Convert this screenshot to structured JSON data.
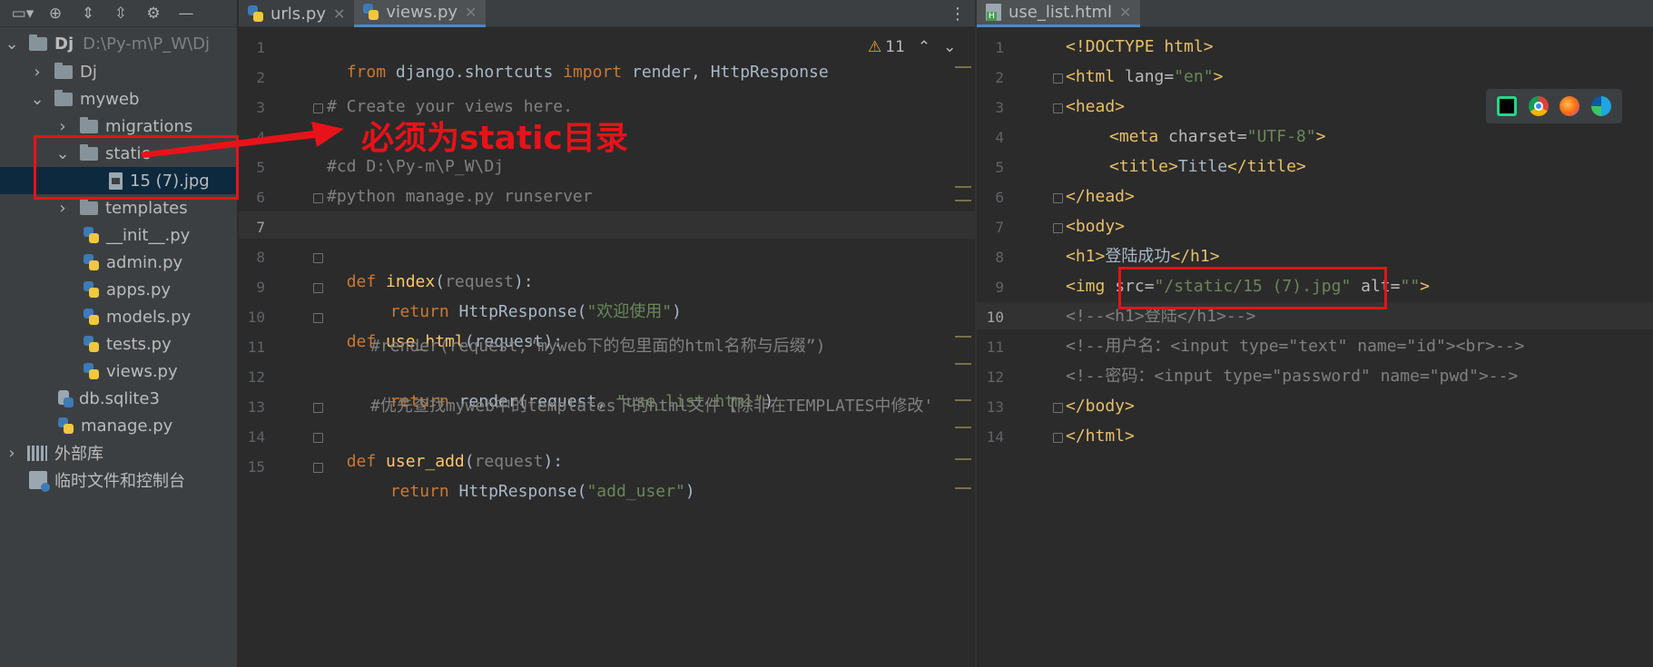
{
  "project": {
    "toolbar_icons": [
      "project-view-icon",
      "locate-icon",
      "expand-all-icon",
      "collapse-all-icon",
      "gear-icon",
      "hide-icon"
    ],
    "tree": [
      {
        "label": "Dj",
        "path": "D:\\Py-m\\P_W\\Dj",
        "type": "folder",
        "expanded": true
      },
      {
        "label": "Dj",
        "type": "folder",
        "expanded": false
      },
      {
        "label": "myweb",
        "type": "folder",
        "expanded": true
      },
      {
        "label": "migrations",
        "type": "folder",
        "expanded": false
      },
      {
        "label": "static",
        "type": "folder",
        "expanded": true
      },
      {
        "label": "15 (7).jpg",
        "type": "image"
      },
      {
        "label": "templates",
        "type": "folder",
        "expanded": false
      },
      {
        "label": "__init__.py",
        "type": "python"
      },
      {
        "label": "admin.py",
        "type": "python"
      },
      {
        "label": "apps.py",
        "type": "python"
      },
      {
        "label": "models.py",
        "type": "python"
      },
      {
        "label": "tests.py",
        "type": "python"
      },
      {
        "label": "views.py",
        "type": "python"
      },
      {
        "label": "db.sqlite3",
        "type": "db"
      },
      {
        "label": "manage.py",
        "type": "python"
      },
      {
        "label": "外部库",
        "type": "libs"
      },
      {
        "label": "临时文件和控制台",
        "type": "scratch"
      }
    ]
  },
  "left_editor": {
    "tabs": [
      {
        "label": "urls.py",
        "active": false
      },
      {
        "label": "views.py",
        "active": true
      }
    ],
    "warnings": "11",
    "current_line": "7",
    "line_numbers": [
      "1",
      "2",
      "3",
      "4",
      "5",
      "6",
      "7",
      "8",
      "9",
      "10",
      "11",
      "12",
      "13",
      "14",
      "15"
    ],
    "lines": {
      "l1": {
        "kw1": "from",
        "mod": " django.shortcuts ",
        "kw2": "import",
        "rest": " render, HttpResponse"
      },
      "l3": "# Create your views here.",
      "l5": "#cd D:\\Py-m\\P_W\\Dj",
      "l6": "#python manage.py runserver",
      "l8": {
        "kw": "def",
        "fn": "index",
        "open": "(",
        "param": "request",
        "close": "):"
      },
      "l9": {
        "kw": "return",
        "call": " HttpResponse(",
        "str": "\"欢迎使用\"",
        "close": ")"
      },
      "l10": {
        "kw": "def",
        "fn": "use_html",
        "rest": "(request):"
      },
      "l11": "#render(request,“myweb下的包里面的html名称与后缀”)",
      "l12": {
        "kw": "return",
        "call": " render(request, ",
        "str": "\"use_list.html\"",
        "close": ")"
      },
      "l13": "#优先查找myweb中的templates下的html文件【除非在TEMPLATES中修改'",
      "l14": {
        "kw": "def",
        "fn": "user_add",
        "open": "(",
        "param": "request",
        "close": "):"
      },
      "l15": {
        "kw": "return",
        "call": " HttpResponse(",
        "str": "\"add_user\"",
        "close": ")"
      }
    }
  },
  "right_editor": {
    "tabs": [
      {
        "label": "use_list.html",
        "active": true
      }
    ],
    "current_line": "10",
    "line_numbers": [
      "1",
      "2",
      "3",
      "4",
      "5",
      "6",
      "7",
      "8",
      "9",
      "10",
      "11",
      "12",
      "13",
      "14"
    ],
    "lines": {
      "l1": "<!DOCTYPE html>",
      "l2": {
        "open": "<html ",
        "attr": "lang=",
        "val": "\"en\"",
        "close": ">"
      },
      "l3": "<head>",
      "l4": {
        "open": "<meta ",
        "attr": "charset=",
        "val": "\"UTF-8\"",
        "close": ">"
      },
      "l5": {
        "open": "<title>",
        "text": "Title",
        "close": "</title>"
      },
      "l6": "</head>",
      "l7": "<body>",
      "l8": {
        "open": "<h1>",
        "text": "登陆成功",
        "close": "</h1>"
      },
      "l9": {
        "open": "<img ",
        "attr": "src=",
        "val": "\"/static/15 (7).jpg\"",
        "attr2": " alt=",
        "val2": "\"\"",
        "close": ">"
      },
      "l10": "<!--<h1>登陆</h1>-->",
      "l11": "<!--用户名：<input type=\"text\" name=\"id\"><br>-->",
      "l12": "<!--密码：<input type=\"password\" name=\"pwd\">-->",
      "l13": "</body>",
      "l14": "</html>"
    },
    "browsers": [
      "pycharm-icon",
      "chrome-icon",
      "firefox-icon",
      "edge-icon"
    ]
  },
  "annotation": {
    "text": "必须为static目录",
    "color": "#e8121a"
  }
}
